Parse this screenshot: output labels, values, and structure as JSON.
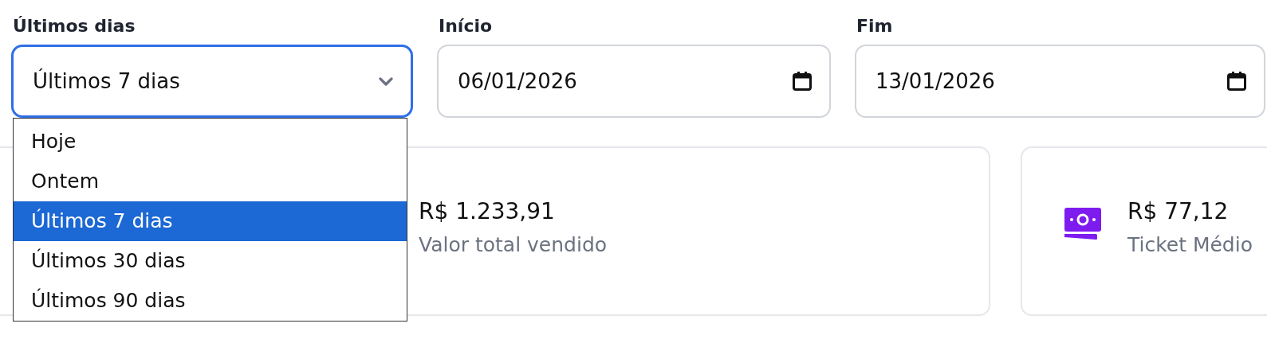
{
  "filters": [
    {
      "kind": "select",
      "label": "Últimos dias",
      "value": "Últimos 7 dias",
      "focused": true,
      "open": true,
      "options": [
        {
          "label": "Hoje",
          "selected": false
        },
        {
          "label": "Ontem",
          "selected": false
        },
        {
          "label": "Últimos 7 dias",
          "selected": true
        },
        {
          "label": "Últimos 30 dias",
          "selected": false
        },
        {
          "label": "Últimos 90 dias",
          "selected": false
        }
      ]
    },
    {
      "kind": "date",
      "label": "Início",
      "value": "06/01/2026",
      "focused": false
    },
    {
      "kind": "date",
      "label": "Fim",
      "value": "13/01/2026",
      "focused": false
    }
  ],
  "cards": [
    {
      "value": "R$ 1.233,91",
      "caption": "Valor total vendido"
    },
    {
      "kind": "money",
      "value": "R$ 77,12",
      "caption": "Ticket Médio"
    }
  ]
}
